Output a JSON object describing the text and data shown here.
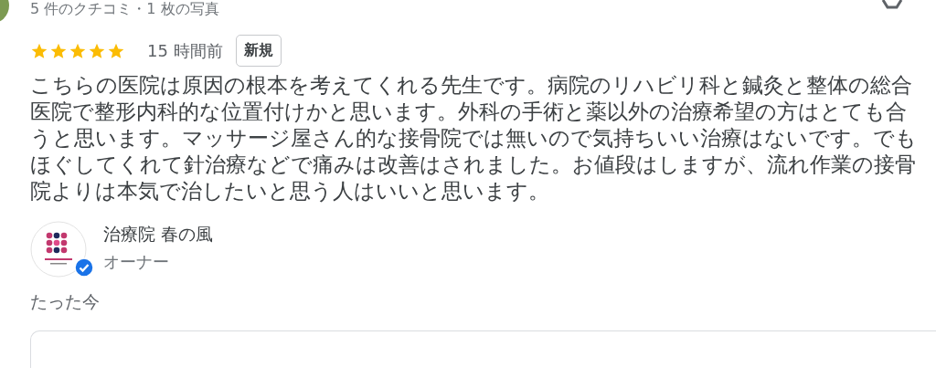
{
  "review_summary": "5 件のクチコミ・1 枚の写真",
  "review": {
    "stars": 5,
    "time": "15 時間前",
    "badge": "新規",
    "text": "こちらの医院は原因の根本を考えてくれる先生です。病院のリハビリ科と鍼灸と整体の総合医院で整形内科的な位置付けかと思います。外科の手術と薬以外の治療希望の方はとても合うと思います。マッサージ屋さん的な接骨院では無いので気持ちいい治療はないです。でもほぐしてくれて針治療などで痛みは改善はされました。お値段はしますが、流れ作業の接骨院よりは本気で治したいと思う人はいいと思います。"
  },
  "owner": {
    "name": "治療院 春の風",
    "role": "オーナー",
    "verified": true
  },
  "reply_time": "たった今"
}
